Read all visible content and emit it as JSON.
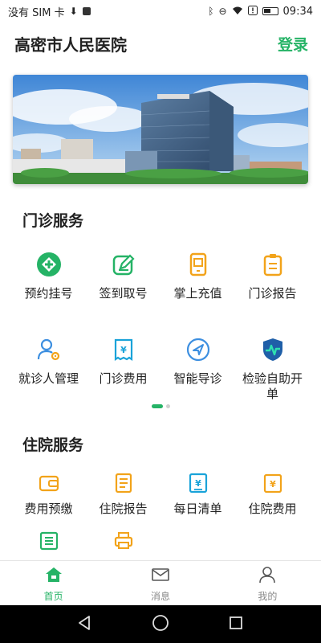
{
  "status_bar": {
    "carrier": "没有 SIM 卡",
    "time": "09:34"
  },
  "header": {
    "title": "高密市人民医院",
    "login_label": "登录"
  },
  "banner": {
    "image_description_icon": "hospital-building-photo"
  },
  "outpatient": {
    "title": "门诊服务",
    "items": [
      {
        "label": "预约挂号",
        "icon": "register-icon"
      },
      {
        "label": "签到取号",
        "icon": "checkin-icon"
      },
      {
        "label": "掌上充值",
        "icon": "recharge-icon"
      },
      {
        "label": "门诊报告",
        "icon": "report-icon"
      },
      {
        "label": "就诊人管理",
        "icon": "patient-manage-icon"
      },
      {
        "label": "门诊费用",
        "icon": "fee-icon"
      },
      {
        "label": "智能导诊",
        "icon": "guide-icon"
      },
      {
        "label": "检验自助开单",
        "icon": "lab-order-icon"
      }
    ]
  },
  "inpatient": {
    "title": "住院服务",
    "items": [
      {
        "label": "费用预缴",
        "icon": "prepay-icon"
      },
      {
        "label": "住院报告",
        "icon": "inpatient-report-icon"
      },
      {
        "label": "每日清单",
        "icon": "daily-list-icon"
      },
      {
        "label": "住院费用",
        "icon": "inpatient-fee-icon"
      }
    ]
  },
  "tabs": [
    {
      "label": "首页",
      "icon": "home-icon",
      "active": true
    },
    {
      "label": "消息",
      "icon": "mail-icon",
      "active": false
    },
    {
      "label": "我的",
      "icon": "user-icon",
      "active": false
    }
  ],
  "colors": {
    "accent": "#25b366",
    "orange": "#f2a31a",
    "blue": "#3d8fe0",
    "cyan": "#1aa3d9"
  }
}
